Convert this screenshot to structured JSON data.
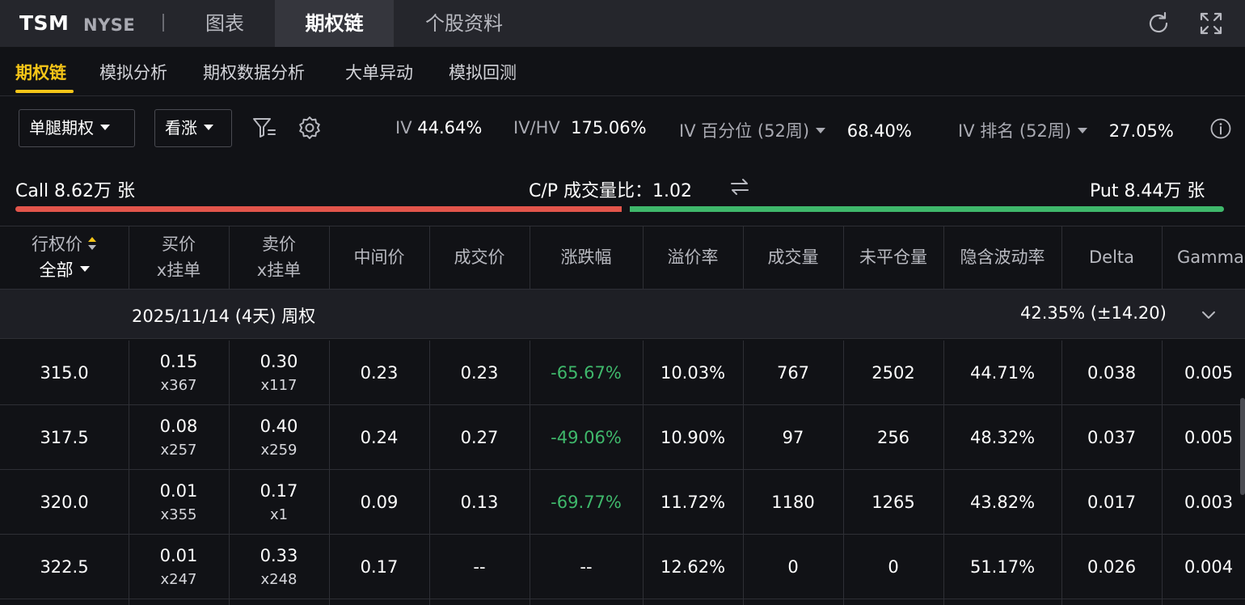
{
  "header": {
    "ticker": "TSM",
    "exchange": "NYSE",
    "tabs": [
      {
        "label": "图表",
        "active": false
      },
      {
        "label": "期权链",
        "active": true
      },
      {
        "label": "个股资料",
        "active": false
      }
    ],
    "icons": [
      "refresh-icon",
      "fullscreen-icon"
    ]
  },
  "subtabs": [
    {
      "label": "期权链",
      "active": true
    },
    {
      "label": "模拟分析",
      "active": false
    },
    {
      "label": "期权数据分析",
      "active": false
    },
    {
      "label": "大单异动",
      "active": false
    },
    {
      "label": "模拟回测",
      "active": false
    }
  ],
  "controls": {
    "strategy_select": "单腿期权",
    "direction_select": "看涨",
    "filter_icon": "filter-icon",
    "settings_icon": "gear-icon"
  },
  "metrics": {
    "iv_label": "IV",
    "iv_value": "44.64%",
    "ivhv_label": "IV/HV",
    "ivhv_value": "175.06%",
    "iv_pct_label": "IV 百分位 (52周)",
    "iv_pct_value": "68.40%",
    "iv_rank_label": "IV 排名 (52周)",
    "iv_rank_value": "27.05%",
    "info_icon": "info-icon"
  },
  "cp_volume": {
    "call_text": "Call 8.62万 张",
    "ratio_label": "C/P 成交量比：",
    "ratio_value": "1.02",
    "swap_icon": "swap-icon",
    "put_text": "Put 8.44万 张",
    "call_share": 0.505,
    "colors": {
      "call": "#e2554b",
      "put": "#3fb86b"
    }
  },
  "table": {
    "strike_header": "行权价",
    "strike_filter": "全部",
    "bid_header": [
      "买价",
      "x挂单"
    ],
    "ask_header": [
      "卖价",
      "x挂单"
    ],
    "headers": [
      "中间价",
      "成交价",
      "涨跌幅",
      "溢价率",
      "成交量",
      "未平仓量",
      "隐含波动率",
      "Delta",
      "Gamma"
    ],
    "group": {
      "label": "2025/11/14 (4天) 周权",
      "iv": "42.35%  (±14.20)"
    },
    "rows": [
      {
        "strike": "315.0",
        "bid": "0.15",
        "bid_size": "x367",
        "ask": "0.30",
        "ask_size": "x117",
        "mid": "0.23",
        "last": "0.23",
        "change": "-65.67%",
        "premium": "10.03%",
        "volume": "767",
        "oi": "2502",
        "iv": "44.71%",
        "delta": "0.038",
        "gamma": "0.005"
      },
      {
        "strike": "317.5",
        "bid": "0.08",
        "bid_size": "x257",
        "ask": "0.40",
        "ask_size": "x259",
        "mid": "0.24",
        "last": "0.27",
        "change": "-49.06%",
        "premium": "10.90%",
        "volume": "97",
        "oi": "256",
        "iv": "48.32%",
        "delta": "0.037",
        "gamma": "0.005"
      },
      {
        "strike": "320.0",
        "bid": "0.01",
        "bid_size": "x355",
        "ask": "0.17",
        "ask_size": "x1",
        "mid": "0.09",
        "last": "0.13",
        "change": "-69.77%",
        "premium": "11.72%",
        "volume": "1180",
        "oi": "1265",
        "iv": "43.82%",
        "delta": "0.017",
        "gamma": "0.003"
      },
      {
        "strike": "322.5",
        "bid": "0.01",
        "bid_size": "x247",
        "ask": "0.33",
        "ask_size": "x248",
        "mid": "0.17",
        "last": "--",
        "change": "--",
        "premium": "12.62%",
        "volume": "0",
        "oi": "0",
        "iv": "51.17%",
        "delta": "0.026",
        "gamma": "0.004"
      }
    ]
  }
}
